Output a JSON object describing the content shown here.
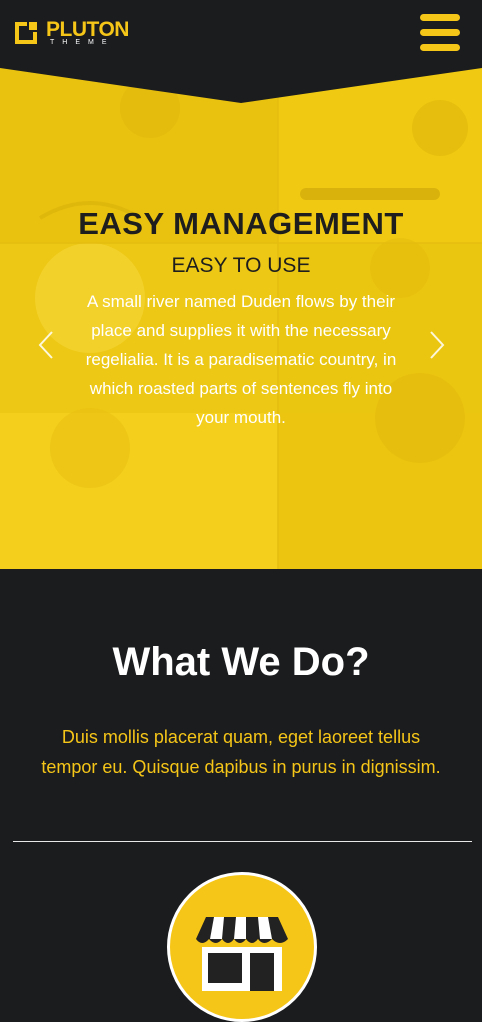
{
  "header": {
    "logo_name": "PLUTON",
    "logo_sub": "THEME",
    "menu_icon": "hamburger-menu-icon"
  },
  "hero": {
    "title": "EASY MANAGEMENT",
    "subtitle": "EASY TO USE",
    "text": "A small river named Duden flows by their place and supplies it with the necessary regelialia. It is a paradisematic country, in which roasted parts of sentences fly into your mouth.",
    "prev_icon": "chevron-left-icon",
    "next_icon": "chevron-right-icon"
  },
  "section": {
    "title": "What We Do?",
    "text": "Duis mollis placerat quam, eget laoreet tellus tempor eu. Quisque dapibus in purus in dignissim.",
    "service_icon": "store-icon"
  },
  "colors": {
    "accent": "#f5c518",
    "background": "#1b1c1e",
    "hero": "#f2cc16"
  }
}
